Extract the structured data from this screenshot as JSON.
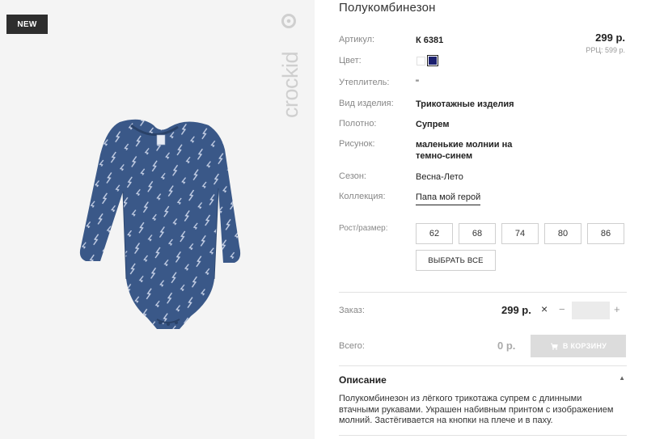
{
  "badge": {
    "label": "NEW"
  },
  "brand": {
    "logo_text": "crockid"
  },
  "product": {
    "title": "Полукомбинезон",
    "price": "299 р.",
    "rrc_price": "РРЦ: 599 р."
  },
  "specs": {
    "article": {
      "label": "Артикул:",
      "value": "К 6381"
    },
    "color": {
      "label": "Цвет:",
      "swatches": [
        "#ffffff",
        "#1a1f6e"
      ]
    },
    "insulation": {
      "label": "Утеплитель:",
      "value": "\""
    },
    "type": {
      "label": "Вид изделия:",
      "value": "Трикотажные изделия"
    },
    "fabric": {
      "label": "Полотно:",
      "value": "Супрем"
    },
    "pattern": {
      "label": "Рисунок:",
      "value_line1": "маленькие молнии на",
      "value_line2": "темно-синем"
    },
    "season": {
      "label": "Сезон:",
      "value": "Весна-Лето"
    },
    "collection": {
      "label": "Коллекция:",
      "value": "Папа мой герой"
    }
  },
  "sizes": {
    "label": "Рост/размер:",
    "options": [
      "62",
      "68",
      "74",
      "80",
      "86"
    ],
    "select_all": "ВЫБРАТЬ ВСЕ"
  },
  "order": {
    "label": "Заказ:",
    "price": "299 р.",
    "times": "×",
    "minus": "−",
    "plus": "+",
    "quantity": ""
  },
  "total": {
    "label": "Всего:",
    "value": "0 р.",
    "cart_button": "В КОРЗИНУ"
  },
  "description": {
    "title": "Описание",
    "line1": "Полукомбинезон из лёгкого трикотажа супрем с длинными",
    "line2": "втачными рукавами. Украшен набивным принтом с изображением",
    "line3": "молний. Застёгивается на кнопки на плече и в паху."
  },
  "colors": {
    "navy_fabric": "#3a5888",
    "swatch_navy": "#1a1f6e",
    "cart_disabled": "#dcdcdc"
  }
}
